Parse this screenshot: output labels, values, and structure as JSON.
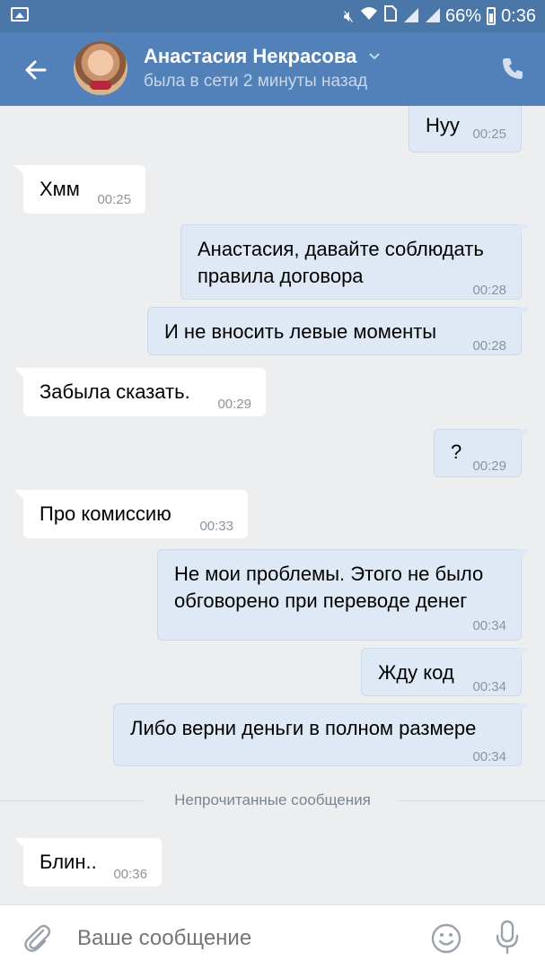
{
  "status_bar": {
    "battery": "66%",
    "time": "0:36"
  },
  "header": {
    "name": "Анастасия Некрасова",
    "status": "была в сети 2 минуты назад"
  },
  "messages": [
    {
      "dir": "out",
      "text": "Нуу",
      "time": "00:25"
    },
    {
      "dir": "in",
      "text": "Хмм",
      "time": "00:25"
    },
    {
      "dir": "out",
      "text": "Анастасия, давайте соблюдать правила договора",
      "time": "00:28"
    },
    {
      "dir": "out",
      "text": "И не вносить левые моменты",
      "time": "00:28"
    },
    {
      "dir": "in",
      "text": "Забыла сказать.",
      "time": "00:29"
    },
    {
      "dir": "out",
      "text": "?",
      "time": "00:29"
    },
    {
      "dir": "in",
      "text": "Про комиссию",
      "time": "00:33"
    },
    {
      "dir": "out",
      "text": "Не мои проблемы. Этого не было обговорено при переводе денег",
      "time": "00:34"
    },
    {
      "dir": "out",
      "text": "Жду код",
      "time": "00:34"
    },
    {
      "dir": "out",
      "text": "Либо верни деньги в полном размере",
      "time": "00:34"
    },
    {
      "dir": "in",
      "text": "Блин..",
      "time": "00:36"
    }
  ],
  "unread_divider": "Непрочитанные сообщения",
  "composer": {
    "placeholder": "Ваше сообщение"
  },
  "colors": {
    "header": "#5181b8",
    "status_bar": "#4a76a8",
    "background": "#edeef0",
    "outgoing_bubble": "#dfe9f5",
    "incoming_bubble": "#ffffff"
  },
  "icons": [
    "gallery-icon",
    "mute-icon",
    "wifi-icon",
    "sim-icon",
    "signal-icon",
    "battery-icon",
    "back-arrow-icon",
    "chevron-down-icon",
    "phone-icon",
    "paperclip-icon",
    "smiley-icon",
    "microphone-icon"
  ]
}
